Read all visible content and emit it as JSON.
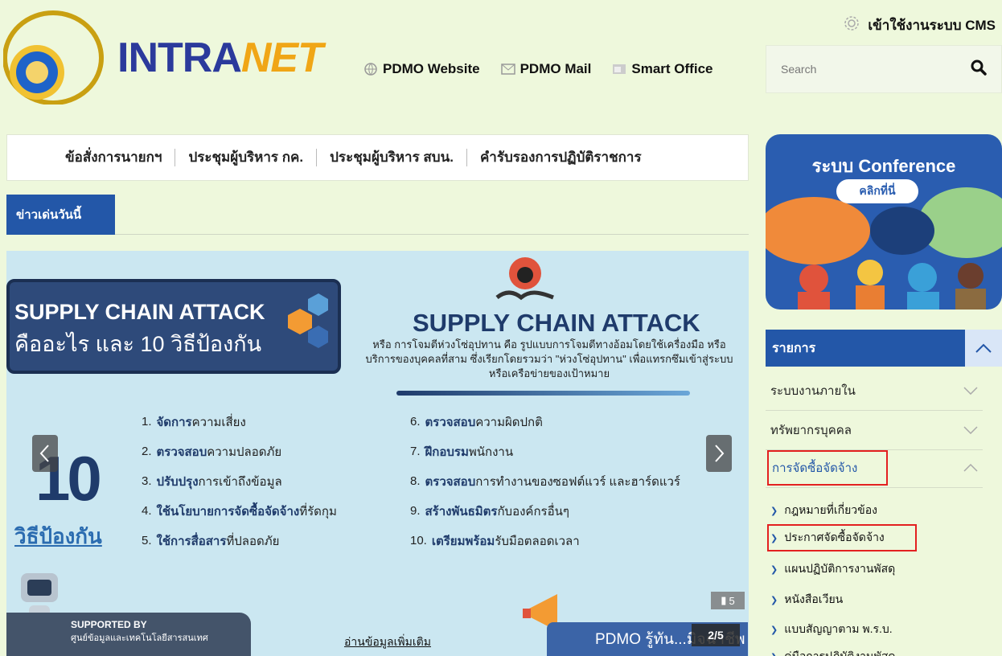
{
  "header": {
    "brand_main": "INTRA",
    "brand_accent": "NET",
    "links": [
      {
        "label": "PDMO Website",
        "icon": "globe-icon"
      },
      {
        "label": "PDMO Mail",
        "icon": "mail-icon"
      },
      {
        "label": "Smart Office",
        "icon": "office-icon"
      }
    ],
    "cms_label": "เข้าใช้งานระบบ CMS",
    "search_placeholder": "Search"
  },
  "menu": {
    "items": [
      "ข้อสั่งการนายกฯ",
      "ประชุมผู้บริหาร กค.",
      "ประชุมผู้บริหาร สบน.",
      "คำรับรองการปฏิบัติราชการ"
    ]
  },
  "news_tab": "ข่าวเด่นวันนี้",
  "banner": {
    "left_title_1": "SUPPLY CHAIN ATTACK",
    "left_title_2": "คืออะไร และ 10 วิธีป้องกัน",
    "title": "SUPPLY CHAIN ATTACK",
    "desc": "หรือ การโจมตีห่วงโซ่อุปทาน คือ รูปแบบการโจมตีทางอ้อมโดยใช้เครื่องมือ หรือบริการของบุคคลที่สาม ซึ่งเรียกโดยรวมว่า \"ห่วงโซ่อุปทาน\" เพื่อแทรกซึมเข้าสู่ระบบหรือเครือข่ายของเป้าหมาย",
    "big_number": "10",
    "big_label": "วิธีป้องกัน",
    "left_items": [
      {
        "num": "1.",
        "bold": "จัดการ",
        "rest": "ความเสี่ยง"
      },
      {
        "num": "2.",
        "bold": "ตรวจสอบ",
        "rest": "ความปลอดภัย"
      },
      {
        "num": "3.",
        "bold": "ปรับปรุง",
        "rest": "การเข้าถึงข้อมูล"
      },
      {
        "num": "4.",
        "bold": "ใช้นโยบายการจัดซื้อจัดจ้าง",
        "rest": "ที่รัดกุม"
      },
      {
        "num": "5.",
        "bold": "ใช้การสื่อสาร",
        "rest": "ที่ปลอดภัย"
      }
    ],
    "right_items": [
      {
        "num": "6.",
        "bold": "ตรวจสอบ",
        "rest": "ความผิดปกติ"
      },
      {
        "num": "7.",
        "bold": "ฝึกอบรม",
        "rest": "พนักงาน"
      },
      {
        "num": "8.",
        "bold": "ตรวจสอบ",
        "rest": "การทำงานของซอฟต์แวร์ และฮาร์ดแวร์"
      },
      {
        "num": "9.",
        "bold": "สร้างพันธมิตร",
        "rest": "กับองค์กรอื่นๆ"
      },
      {
        "num": "10.",
        "bold": "เตรียมพร้อม",
        "rest": "รับมือตลอดเวลา"
      }
    ],
    "supported_1": "SUPPORTED BY",
    "supported_2": "ศูนย์ข้อมูลและเทคโนโลยีสารสนเทศ",
    "read_more": "อ่านข้อมูลเพิ่มเติม",
    "pdmo_text": "PDMO รู้ทัน...มิจฉาชีพ",
    "counter": "2/5",
    "views": "5"
  },
  "sidebar": {
    "conf_title": "ระบบ Conference",
    "conf_button": "คลิกที่นี่",
    "list_title": "รายการ",
    "accordions": [
      {
        "label": "ระบบงานภายใน",
        "open": false
      },
      {
        "label": "ทรัพยากรบุคคล",
        "open": false
      },
      {
        "label": "การจัดซื้อจัดจ้าง",
        "open": true
      }
    ],
    "sub_items": [
      "กฎหมายที่เกี่ยวข้อง",
      "ประกาศจัดซื้อจัดจ้าง",
      "แผนปฏิบัติการงานพัสดุ",
      "หนังสือเวียน",
      "แบบสัญญาตาม พ.ร.บ.",
      "คู่มือการปฏิบัติงานพัสดุ"
    ]
  }
}
